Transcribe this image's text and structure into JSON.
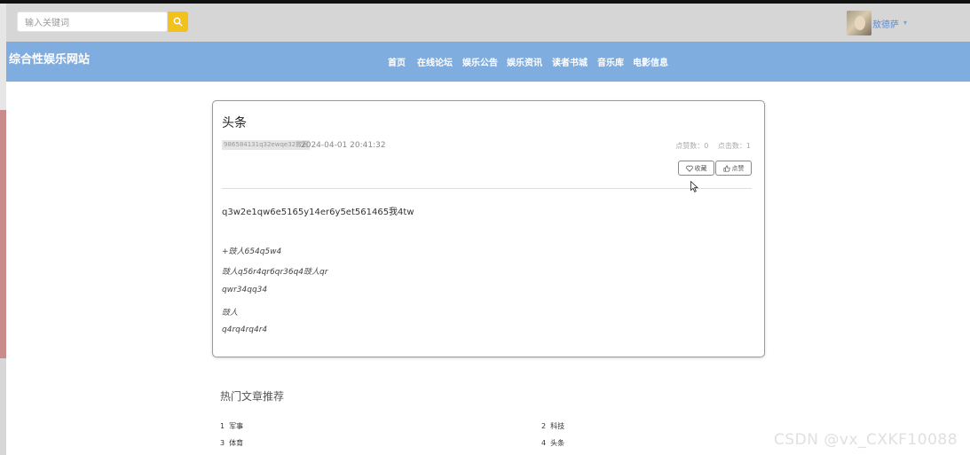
{
  "header": {
    "search": {
      "placeholder": "输入关键词"
    },
    "user": {
      "name": "敖德萨"
    }
  },
  "nav": {
    "site_title": "综合性娱乐网站",
    "items": [
      "首页",
      "在线论坛",
      "娱乐公告",
      "娱乐资讯",
      "读者书城",
      "音乐库",
      "电影信息"
    ]
  },
  "article": {
    "title": "头条",
    "tag": "986584131q32ewqe32撒司",
    "time": "2024-04-01 20:41:32",
    "likes_label": "点赞数：0",
    "clicks_label": "点击数：1",
    "favorite_label": "收藏",
    "like_label": "点赞",
    "lead": "q3w2e1qw6e5165y14er6y5et561465我4tw",
    "lines": [
      "+豉人654q5w4",
      "豉人q56r4qr6qr36q4豉人qr",
      "qwr34qq34",
      "豉人",
      "q4rq4rq4r4"
    ]
  },
  "recommend": {
    "title": "热门文章推荐",
    "items": [
      {
        "num": "1",
        "label": "军事"
      },
      {
        "num": "2",
        "label": "科技"
      },
      {
        "num": "3",
        "label": "体育"
      },
      {
        "num": "4",
        "label": "头条"
      }
    ]
  },
  "watermark": "CSDN @vx_CXKF10088",
  "colors": {
    "nav_bg": "#80ade0",
    "search_button": "#f2c21b",
    "topbar_bg": "#d6d6d6"
  }
}
